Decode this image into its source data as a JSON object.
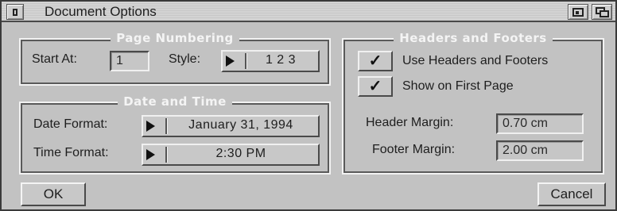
{
  "window": {
    "title": "Document Options"
  },
  "page_numbering": {
    "group_title": "Page Numbering",
    "start_at_label": "Start At:",
    "start_at_value": "1",
    "style_label": "Style:",
    "style_value": "1 2 3"
  },
  "date_time": {
    "group_title": "Date and Time",
    "date_format_label": "Date Format:",
    "date_format_value": "January 31, 1994",
    "time_format_label": "Time Format:",
    "time_format_value": "2:30 PM"
  },
  "headers_footers": {
    "group_title": "Headers and Footers",
    "use_headers_label": "Use Headers and Footers",
    "use_headers_checked": "✓",
    "show_first_label": "Show on First Page",
    "show_first_checked": "✓",
    "header_margin_label": "Header Margin:",
    "header_margin_value": "0.70 cm",
    "footer_margin_label": "Footer Margin:",
    "footer_margin_value": "2.00 cm"
  },
  "buttons": {
    "ok": "OK",
    "cancel": "Cancel"
  },
  "icons": {
    "close": "close-box-icon",
    "depth": "depth-arrange-icon",
    "zoom": "zoom-icon",
    "cycle": "cycle-arrow-icon",
    "check": "checkmark-icon"
  }
}
